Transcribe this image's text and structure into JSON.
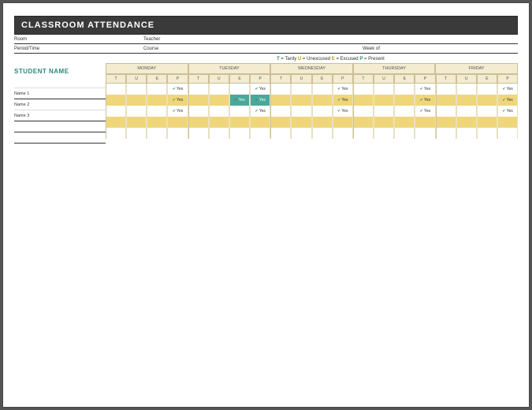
{
  "header": {
    "title": "CLASSROOM ATTENDANCE"
  },
  "meta": {
    "room_label": "Room",
    "teacher_label": "Teacher",
    "period_label": "Period/Time",
    "course_label": "Course",
    "week_label": "Week of"
  },
  "legend": {
    "t_code": "T",
    "t_text": " = Tardy  ",
    "u_code": "U",
    "u_text": " = Unexcused  ",
    "e_code": "E",
    "e_text": " = Excused  ",
    "p_code": "P",
    "p_text": " = Present"
  },
  "columns": {
    "student_header": "STUDENT NAME",
    "days": [
      "MONDAY",
      "TUESDAY",
      "WEDNESDAY",
      "THURSDAY",
      "FRIDAY"
    ],
    "subcols": [
      "T",
      "U",
      "E",
      "P"
    ]
  },
  "students": [
    "Name 1",
    "Name 2",
    "Name 3",
    "",
    ""
  ],
  "yes": "Yes",
  "attendance": [
    [
      [
        0,
        0,
        0,
        1
      ],
      [
        0,
        0,
        0,
        1
      ],
      [
        0,
        0,
        0,
        1
      ],
      [
        0,
        0,
        0,
        1
      ],
      [
        0,
        0,
        0,
        1
      ]
    ],
    [
      [
        0,
        0,
        0,
        1
      ],
      [
        0,
        0,
        2,
        2
      ],
      [
        0,
        0,
        0,
        1
      ],
      [
        0,
        0,
        0,
        1
      ],
      [
        0,
        0,
        0,
        1
      ]
    ],
    [
      [
        0,
        0,
        0,
        1
      ],
      [
        0,
        0,
        0,
        1
      ],
      [
        0,
        0,
        0,
        1
      ],
      [
        0,
        0,
        0,
        1
      ],
      [
        0,
        0,
        0,
        1
      ]
    ],
    [
      [
        0,
        0,
        0,
        0
      ],
      [
        0,
        0,
        0,
        0
      ],
      [
        0,
        0,
        0,
        0
      ],
      [
        0,
        0,
        0,
        0
      ],
      [
        0,
        0,
        0,
        0
      ]
    ],
    [
      [
        0,
        0,
        0,
        0
      ],
      [
        0,
        0,
        0,
        0
      ],
      [
        0,
        0,
        0,
        0
      ],
      [
        0,
        0,
        0,
        0
      ],
      [
        0,
        0,
        0,
        0
      ]
    ]
  ]
}
